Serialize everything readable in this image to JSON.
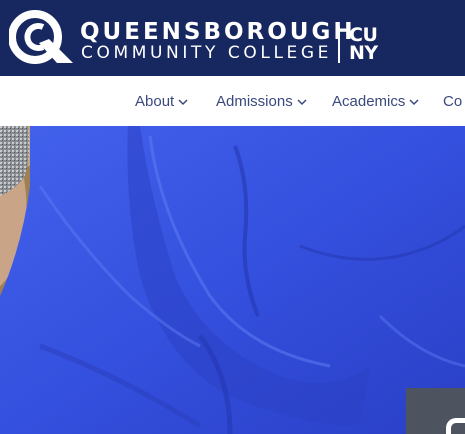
{
  "header": {
    "college_name_line1": "QUEENSBOROUGH",
    "college_name_line2": "COMMUNITY COLLEGE",
    "cuny_line1": "CU",
    "cuny_line2": "NY",
    "logo_icon": "qcc-q-logo-icon",
    "background_color": "#17275f"
  },
  "nav": {
    "items": [
      {
        "label": "About",
        "icon": "chevron-down-icon"
      },
      {
        "label": "Admissions",
        "icon": "chevron-down-icon"
      },
      {
        "label": "Academics",
        "icon": "chevron-down-icon"
      },
      {
        "label": "Co",
        "icon": ""
      }
    ],
    "text_color": "#3a4a7e"
  },
  "hero": {
    "description_color": "#3451df",
    "overlay_card_color": "#4e5360"
  }
}
